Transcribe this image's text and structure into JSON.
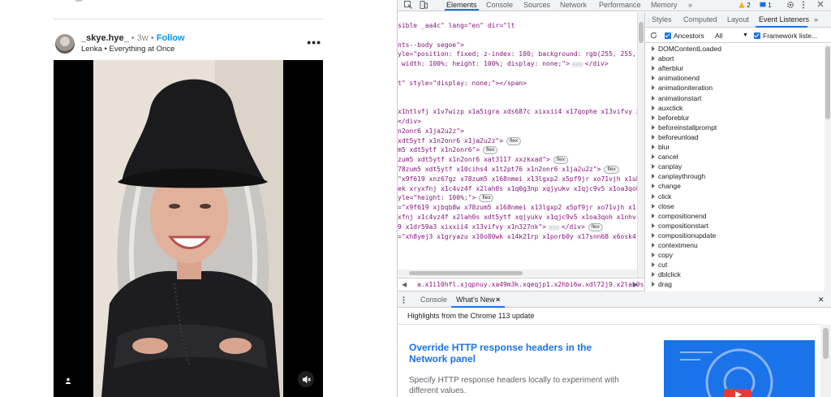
{
  "instagram": {
    "post": {
      "username": "_skye.hye_",
      "separator": "•",
      "time_ago": "3w",
      "follow_label": "Follow",
      "music": "Lenka • Everything at Once",
      "more_label": "•••"
    },
    "icons": {
      "user_tag": "person-icon",
      "mute": "mute-icon"
    }
  },
  "devtools": {
    "toolbar": {
      "tabs": [
        "Elements",
        "Console",
        "Sources",
        "Network",
        "Performance",
        "Memory"
      ],
      "active_tab": "Elements",
      "overflow": "»",
      "warning_count": "2",
      "message_count": "1"
    },
    "elements_code": [
      {
        "text": "sible _aa4c\" lang=\"en\" dir=\"lt"
      },
      {
        "text": ""
      },
      {
        "text": "nts--body segoe\">"
      },
      {
        "text": "yle=\"position: fixed; z-index: 100; background: rgb(255, 255,"
      },
      {
        "text": " width: 100%; height: 100%; display: none;\">",
        "ellipsis": true,
        "tail": "</div>"
      },
      {
        "text": ""
      },
      {
        "text": "t\" style=\"display: none;\"></span>"
      },
      {
        "text": ""
      },
      {
        "text": ""
      },
      {
        "text": "x1htlvfj x1v7wizp x1a5igra xds687c xixxii4 x17qophe x13vifvy x"
      },
      {
        "text": "</div>"
      },
      {
        "text": "n2onr6 x1ja2u2z\">"
      },
      {
        "text": "xdt5ytf x1n2onr6 x1ja2u2z\">",
        "pill": "flex"
      },
      {
        "text": "m5 xdt5ytf x1n2onr6\">",
        "pill": "flex"
      },
      {
        "text": "zum5 xdt5ytf x1n2onr6 xat3117 xxzkxad\">",
        "pill": "flex"
      },
      {
        "text": "78zum5 xdt5ytf x10cihs4 x1t2pt76 x1n2onr6 x1ja2u2z\">",
        "pill": "flex"
      },
      {
        "text": "\"x9f619 xnz67gz x78zum5 x168nmei x13lgxp2 x5pf9jr xo71vjh x1uh"
      },
      {
        "text": "ek xryxfnj x1c4vz4f x2lah0s x1q0g3np xqjyukv x1qjc9v5 x1oa3qoh"
      },
      {
        "text": "yle=\"height: 100%;\">",
        "pill": "flex"
      },
      {
        "text": "=\"x9f619 xjbqb8w x78zum5 x168nmei x13lgxp2 x5pf9jr xo71vjh x1"
      },
      {
        "text": "xfnj x1c4vz4f x2lah0s xdt5ytf xqjyukv x1qjc9v5 x1oa3qoh x1nhv"
      },
      {
        "text": "9 x1dr59a3 xixxii4 x13vifvy x1n327nk\">",
        "ellipsis": true,
        "tail": "</div>",
        "pill": "flex"
      },
      {
        "text": "=\"xh8yej3 x1gryazu x10o80wk x14k21rp x1porb0y x17snn68 x6osk4"
      }
    ],
    "breadcrumb": "a.x1i10hfl.xjqpnuy.xa49m3k.xqeqjp1.x2hbi6w.xdl72j9.x2lah0s.xe8uvvx.x",
    "side_tabs": [
      "Styles",
      "Computed",
      "Layout",
      "Event Listeners"
    ],
    "side_active": "Event Listeners",
    "side_overflow": "»",
    "listener_toolbar": {
      "ancestors_label": "Ancestors",
      "filter_value": "All",
      "framework_label": "Framework liste..."
    },
    "events": [
      "DOMContentLoaded",
      "abort",
      "afterblur",
      "animationend",
      "animationiteration",
      "animationstart",
      "auxclick",
      "beforeblur",
      "beforeinstallprompt",
      "beforeunload",
      "blur",
      "cancel",
      "canplay",
      "canplaythrough",
      "change",
      "click",
      "close",
      "compositionend",
      "compositionstart",
      "compositionupdate",
      "contextmenu",
      "copy",
      "cut",
      "dblclick",
      "drag"
    ],
    "drawer": {
      "tabs": [
        "Console",
        "What's New"
      ],
      "active": "What's New",
      "close_tab": "×",
      "close_drawer": "✕",
      "highlights": "Highlights from the Chrome 113 update",
      "title": "Override HTTP response headers in the Network panel",
      "desc": "Specify HTTP response headers locally to experiment with different values."
    },
    "colors": {
      "accent": "#1a73e8",
      "tag": "#881280",
      "attr": "#994500",
      "value": "#1a1aa6"
    }
  }
}
